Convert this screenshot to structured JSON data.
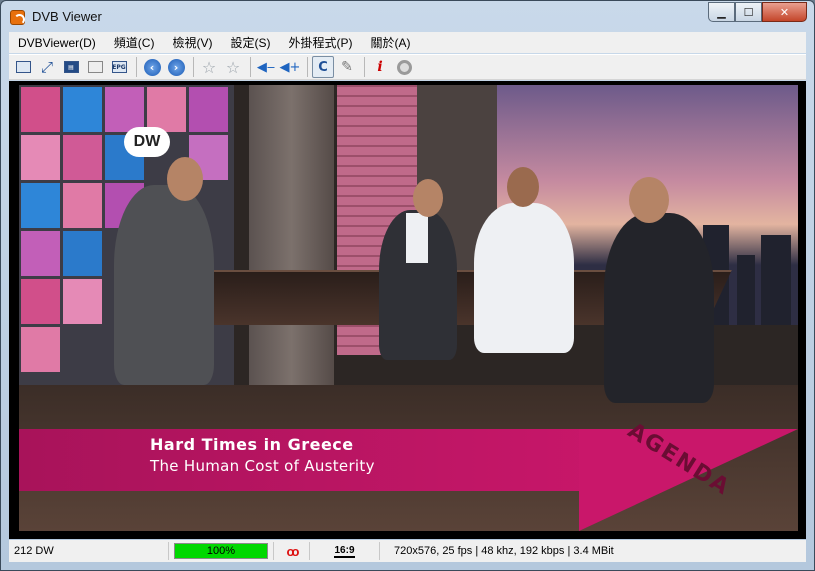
{
  "window": {
    "title": "DVB Viewer",
    "icon": "dvbviewer-app-icon",
    "min_glyph": "▁",
    "max_glyph": "☐",
    "close_glyph": "✕"
  },
  "menu": [
    {
      "label": "DVBViewer(D)"
    },
    {
      "label": "頻道(C)"
    },
    {
      "label": "檢視(V)"
    },
    {
      "label": "設定(S)"
    },
    {
      "label": "外掛程式(P)"
    },
    {
      "label": "關於(A)"
    }
  ],
  "toolbar": {
    "epg_label": "EPG",
    "icons": [
      "window-mode-icon",
      "fullscreen-icon",
      "teletext-icon",
      "osd-icon",
      "epg-icon",
      "back-icon",
      "forward-icon",
      "favorite-icon",
      "favorite-add-icon",
      "volume-down-icon",
      "volume-up-icon",
      "recorder-icon",
      "settings-wrench-icon",
      "info-icon",
      "record-icon"
    ]
  },
  "video": {
    "caption_title": "Hard Times in Greece",
    "caption_subtitle": "The Human Cost of Austerity",
    "corner_text": "AGENDA",
    "logo_text": "DW"
  },
  "status": {
    "channel": "212 DW",
    "signal_label": "100%",
    "signal_fraction": 1.0,
    "aspect": "16:9",
    "stream_info": "720x576, 25 fps | 48 khz, 192 kbps | 3.4 MBit"
  },
  "colors": {
    "caption_band": "#c9176a",
    "signal": "#00d800"
  }
}
